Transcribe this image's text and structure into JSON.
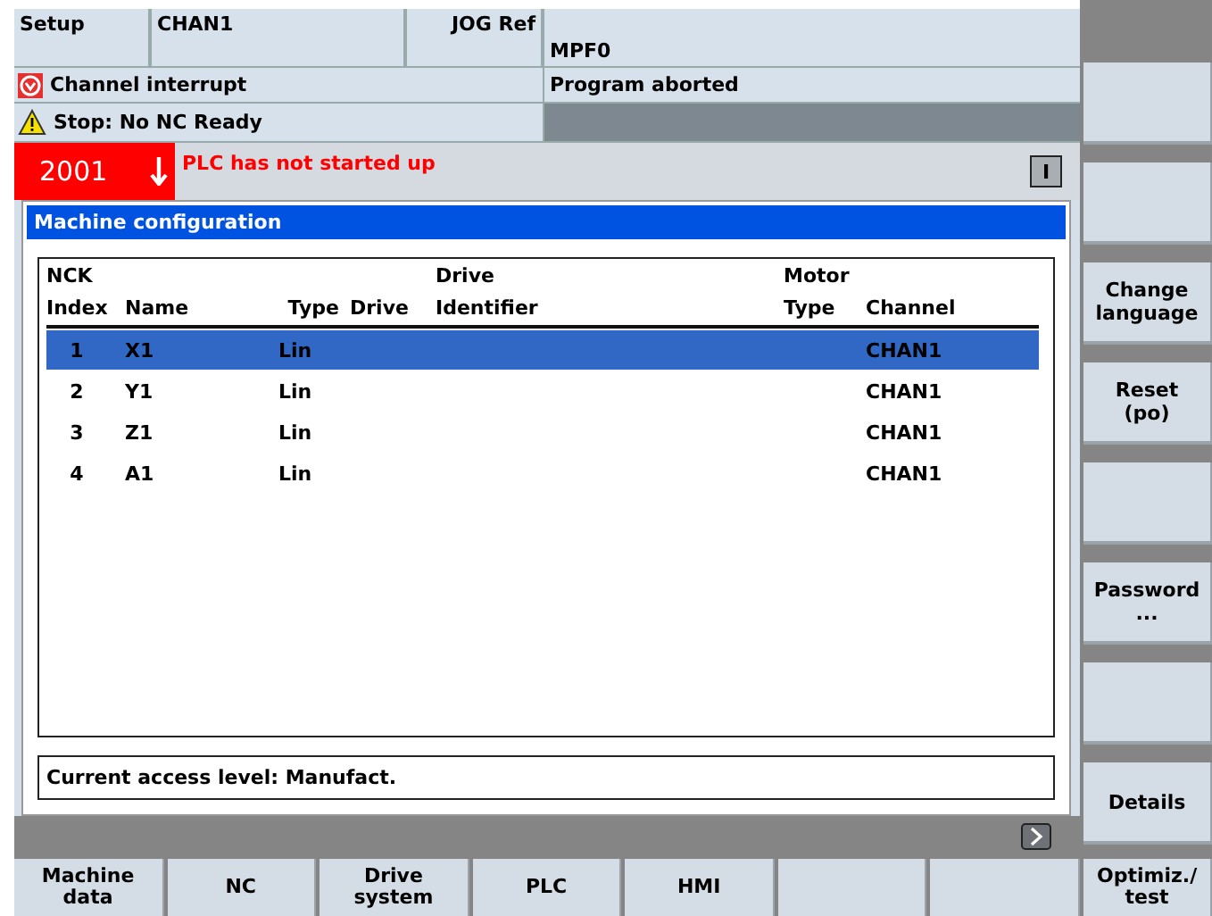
{
  "header": {
    "area": "Setup",
    "channel": "CHAN1",
    "mode": "JOG Ref",
    "program": "MPF0"
  },
  "status": {
    "channel_state": "Channel interrupt",
    "program_state": "Program aborted",
    "stop_message": "Stop: No NC Ready"
  },
  "alarm": {
    "number": "2001",
    "text": "PLC has not started up",
    "ack_symbol": "I"
  },
  "panel": {
    "title": "Machine configuration",
    "columns": [
      {
        "top": "NCK",
        "bottom": "Index"
      },
      {
        "bottom": "Name"
      },
      {
        "bottom": "Type"
      },
      {
        "bottom": "Drive"
      },
      {
        "top": "Drive",
        "bottom": "Identifier"
      },
      {
        "top": "Motor",
        "bottom": "Type"
      },
      {
        "bottom": "Channel"
      }
    ],
    "rows": [
      {
        "index": "1",
        "name": "X1",
        "type": "Lin",
        "channel": "CHAN1",
        "selected": true
      },
      {
        "index": "2",
        "name": "Y1",
        "type": "Lin",
        "channel": "CHAN1",
        "selected": false
      },
      {
        "index": "3",
        "name": "Z1",
        "type": "Lin",
        "channel": "CHAN1",
        "selected": false
      },
      {
        "index": "4",
        "name": "A1",
        "type": "Lin",
        "channel": "CHAN1",
        "selected": false
      }
    ],
    "access_level": "Current access level: Manufact."
  },
  "vertical_softkeys": [
    {
      "kind": "blank"
    },
    {
      "kind": "blank"
    },
    {
      "kind": "labeled",
      "label": "Change language"
    },
    {
      "kind": "labeled",
      "label": "Reset (po)"
    },
    {
      "kind": "blank"
    },
    {
      "kind": "labeled",
      "label": "Password ..."
    },
    {
      "kind": "blank"
    },
    {
      "kind": "labeled",
      "label": "Details"
    }
  ],
  "horizontal_softkeys": [
    {
      "kind": "labeled",
      "label": "Machine data"
    },
    {
      "kind": "labeled",
      "label": "NC"
    },
    {
      "kind": "labeled",
      "label": "Drive system"
    },
    {
      "kind": "labeled",
      "label": "PLC"
    },
    {
      "kind": "labeled",
      "label": "HMI"
    },
    {
      "kind": "blank"
    },
    {
      "kind": "blank"
    },
    {
      "kind": "labeled",
      "label": "Optimiz./ test"
    }
  ]
}
